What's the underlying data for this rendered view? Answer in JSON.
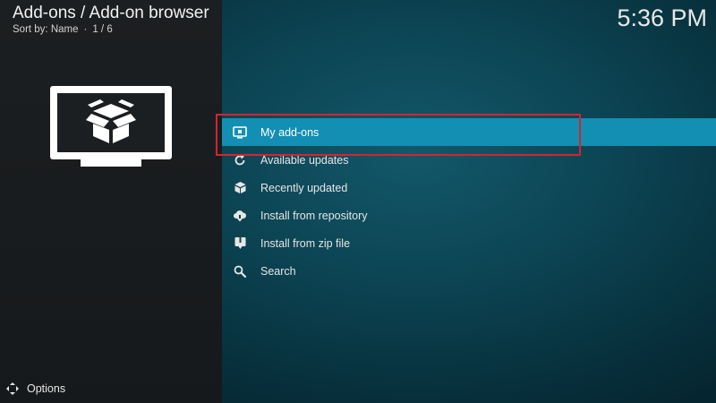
{
  "header": {
    "title": "Add-ons / Add-on browser",
    "sort_label": "Sort by: Name",
    "sort_separator": "·",
    "page_counter": "1 / 6"
  },
  "clock": "5:36 PM",
  "menu": {
    "items": [
      {
        "label": "My add-ons",
        "icon": "tv-box-icon",
        "focused": true
      },
      {
        "label": "Available updates",
        "icon": "refresh-icon",
        "focused": false
      },
      {
        "label": "Recently updated",
        "icon": "box-star-icon",
        "focused": false
      },
      {
        "label": "Install from repository",
        "icon": "cloud-download-icon",
        "focused": false
      },
      {
        "label": "Install from zip file",
        "icon": "zip-download-icon",
        "focused": false
      },
      {
        "label": "Search",
        "icon": "search-icon",
        "focused": false
      }
    ]
  },
  "footer": {
    "options_label": "Options"
  },
  "colors": {
    "focus": "#128fb3",
    "annotation_box": "#d8232e",
    "left_panel": "#1c1f21",
    "background": "#0c4453"
  }
}
